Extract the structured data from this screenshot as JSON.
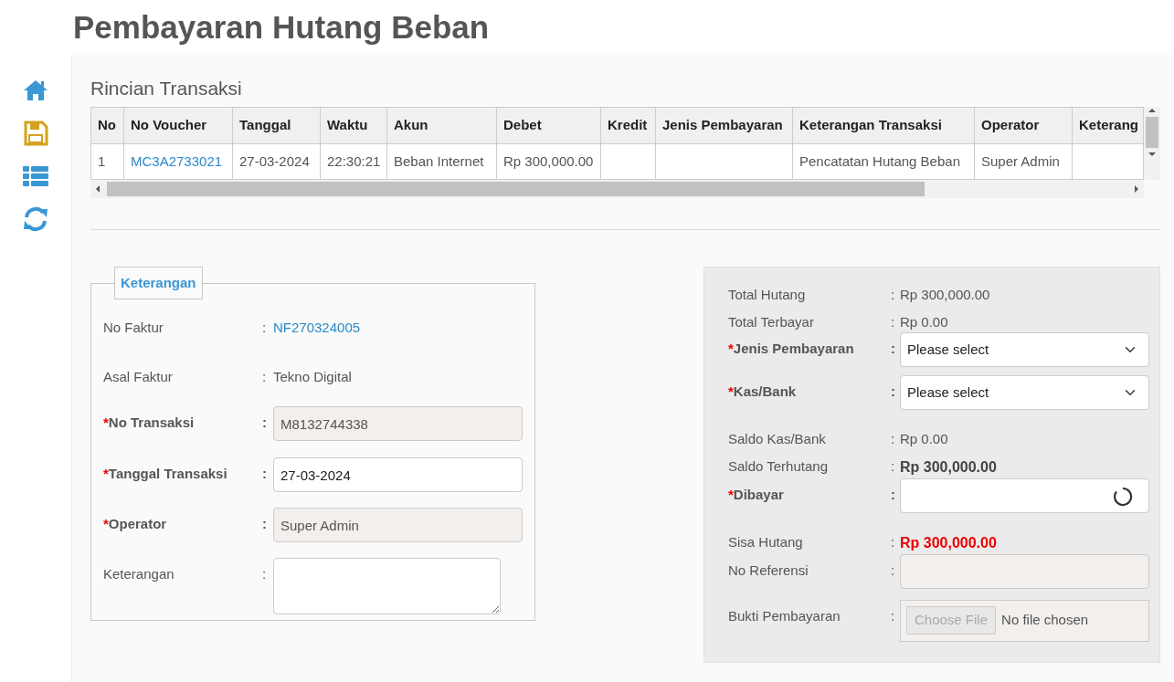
{
  "page_title": "Pembayaran Hutang Beban",
  "sidebar": [
    {
      "kind": "home"
    },
    {
      "kind": "save"
    },
    {
      "kind": "list"
    },
    {
      "kind": "refresh"
    }
  ],
  "transactions": {
    "title": "Rincian Transaksi",
    "columns": [
      "No",
      "No Voucher",
      "Tanggal",
      "Waktu",
      "Akun",
      "Debet",
      "Kredit",
      "Jenis Pembayaran",
      "Keterangan Transaksi",
      "Operator",
      "Keterang"
    ],
    "rows": [
      {
        "cells": [
          {
            "text": "1"
          },
          {
            "text": "MC3A2733021",
            "link": true
          },
          {
            "text": "27-03-2024"
          },
          {
            "text": "22:30:21"
          },
          {
            "text": "Beban Internet"
          },
          {
            "text": "Rp 300,000.00"
          },
          null,
          null,
          {
            "text": "Pencatatan Hutang Beban"
          },
          {
            "text": "Super Admin"
          },
          null
        ]
      }
    ]
  },
  "keterangan": {
    "legend": "Keterangan",
    "fields": [
      {
        "kind": "link",
        "label": "No Faktur",
        "required": false,
        "separator": ":",
        "value": "NF270324005"
      },
      {
        "kind": "text",
        "label": "Asal Faktur",
        "required": false,
        "separator": ":",
        "value": "Tekno Digital"
      },
      {
        "kind": "input",
        "label": "No Transaksi",
        "required": true,
        "asterisk": "*",
        "separator": ":",
        "value": "M8132744338",
        "disabled": true
      },
      {
        "kind": "input",
        "label": "Tanggal Transaksi",
        "required": true,
        "asterisk": "*",
        "separator": ":",
        "value": "27-03-2024",
        "disabled": false
      },
      {
        "kind": "input",
        "label": "Operator",
        "required": true,
        "asterisk": "*",
        "separator": ":",
        "value": "Super Admin",
        "disabled": true
      },
      {
        "kind": "textarea",
        "label": "Keterangan",
        "required": false,
        "separator": ":"
      }
    ]
  },
  "payment": {
    "fields": [
      {
        "kind": "text",
        "label": "Total Hutang",
        "required": false,
        "separator": ":",
        "value": "Rp 300,000.00"
      },
      {
        "kind": "text",
        "label": "Total Terbayar",
        "required": false,
        "separator": ":",
        "value": "Rp 0.00"
      },
      {
        "kind": "select",
        "label": "Jenis Pembayaran",
        "required": true,
        "asterisk": "*",
        "separator": ":",
        "value": "Please select"
      },
      {
        "kind": "select",
        "label": "Kas/Bank",
        "required": true,
        "asterisk": "*",
        "separator": ":",
        "value": "Please select"
      },
      {
        "kind": "text",
        "label": "Saldo Kas/Bank",
        "required": false,
        "separator": ":",
        "value": "Rp 0.00"
      },
      {
        "kind": "strong",
        "label": "Saldo Terhutang",
        "required": false,
        "separator": ":",
        "value": "Rp 300,000.00"
      },
      {
        "kind": "input",
        "label": "Dibayar",
        "required": true,
        "asterisk": "*",
        "separator": ":",
        "disabled": false,
        "loading": true
      },
      {
        "kind": "alert",
        "label": "Sisa Hutang",
        "required": false,
        "separator": ":",
        "value": "Rp 300,000.00"
      },
      {
        "kind": "input",
        "label": "No Referensi",
        "required": false,
        "separator": ":",
        "disabled": true,
        "loading": false
      },
      {
        "kind": "file",
        "label": "Bukti Pembayaran",
        "required": false,
        "separator": ":",
        "button": "Choose File",
        "status": "No file chosen",
        "disabled": true
      }
    ]
  }
}
